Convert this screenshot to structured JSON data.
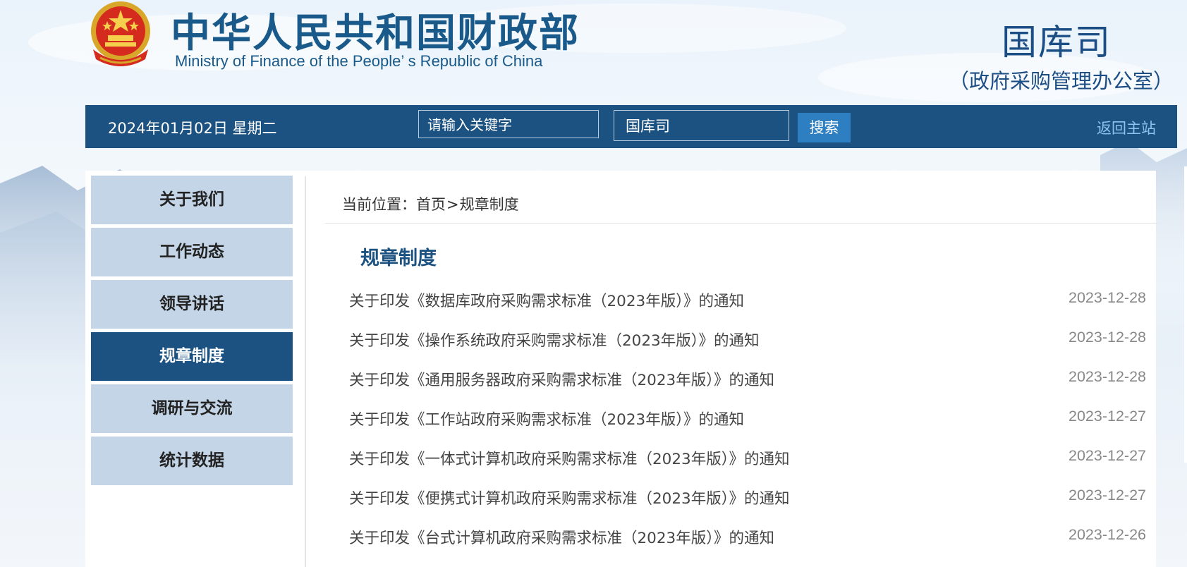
{
  "header": {
    "title_cn": "中华人民共和国财政部",
    "title_en": "Ministry of Finance of the People’ s Republic of China",
    "dept_name": "国库司",
    "dept_sub": "（政府采购管理办公室）"
  },
  "colors": {
    "brand_blue": "#1c5282",
    "sidebar_inactive": "#c3d5e6",
    "search_button": "#2e7fc1",
    "home_link": "#8dc3ec"
  },
  "navbar": {
    "date": "2024年01月02日  星期二",
    "search_placeholder": "请输入关键字",
    "scope_value": "国库司",
    "search_button": "搜索",
    "home_link": "返回主站"
  },
  "sidebar": {
    "items": [
      {
        "label": "关于我们"
      },
      {
        "label": "工作动态"
      },
      {
        "label": "领导讲话"
      },
      {
        "label": "规章制度",
        "active": true
      },
      {
        "label": "调研与交流"
      },
      {
        "label": "统计数据"
      }
    ]
  },
  "breadcrumb": {
    "prefix": "当前位置：",
    "home": "首页",
    "separator": ">",
    "current": "规章制度"
  },
  "section": {
    "title": "规章制度"
  },
  "articles": [
    {
      "title": "关于印发《数据库政府采购需求标准（2023年版）》的通知",
      "date": "2023-12-28"
    },
    {
      "title": "关于印发《操作系统政府采购需求标准（2023年版）》的通知",
      "date": "2023-12-28"
    },
    {
      "title": "关于印发《通用服务器政府采购需求标准（2023年版）》的通知",
      "date": "2023-12-28"
    },
    {
      "title": "关于印发《工作站政府采购需求标准（2023年版）》的通知",
      "date": "2023-12-27"
    },
    {
      "title": "关于印发《一体式计算机政府采购需求标准（2023年版）》的通知",
      "date": "2023-12-27"
    },
    {
      "title": "关于印发《便携式计算机政府采购需求标准（2023年版）》的通知",
      "date": "2023-12-27"
    },
    {
      "title": "关于印发《台式计算机政府采购需求标准（2023年版）》的通知",
      "date": "2023-12-26"
    }
  ]
}
